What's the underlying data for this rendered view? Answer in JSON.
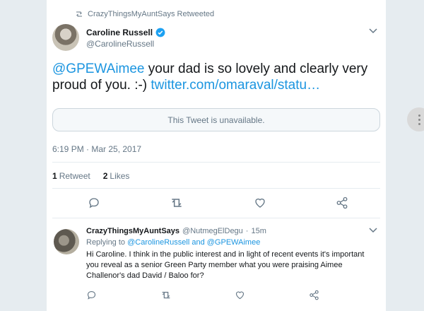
{
  "retweet_context": {
    "text": "CrazyThingsMyAuntSays Retweeted"
  },
  "tweet": {
    "author_name": "Caroline Russell",
    "author_handle": "@CarolineRussell",
    "mention": "@GPEWAimee",
    "body": " your dad is so lovely and clearly very proud of you. :-) ",
    "link": "twitter.com/omaraval/statu…",
    "quote_unavailable": "This Tweet is unavailable.",
    "timestamp": "6:19 PM · Mar 25, 2017",
    "retweets_count": "1",
    "retweets_label": "Retweet",
    "likes_count": "2",
    "likes_label": "Likes"
  },
  "reply": {
    "author_name": "CrazyThingsMyAuntSays",
    "author_handle": "@NutmegElDegu",
    "separator": "·",
    "time": "15m",
    "replying_prefix": "Replying to ",
    "replying_to": "@CarolineRussell and @GPEWAimee",
    "body": "Hi Caroline. I think in the public interest and in light of recent events it's important you reveal as a senior Green Party member what you were praising Aimee Challenor's dad David / Baloo for?"
  },
  "colors": {
    "link": "#1b95e0",
    "muted": "#657786",
    "verified": "#1da1f2"
  },
  "icons": [
    "retweet-icon",
    "verified-icon",
    "chevron-down-icon",
    "reply-icon",
    "like-icon",
    "share-icon",
    "more-icon"
  ]
}
